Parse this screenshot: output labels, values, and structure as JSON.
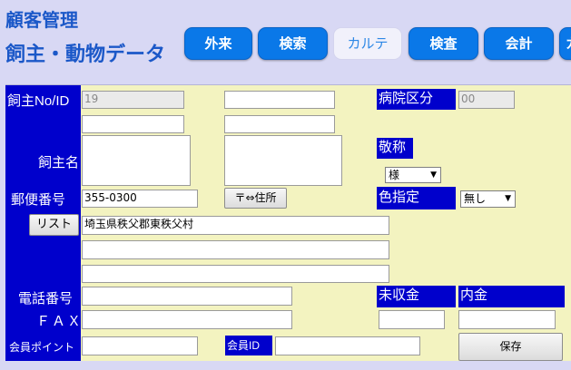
{
  "header": {
    "title_line1": "顧客管理",
    "title_line2": "飼主・動物データ"
  },
  "tabs": [
    {
      "label": "外来",
      "active": false
    },
    {
      "label": "検索",
      "active": false
    },
    {
      "label": "カルテ",
      "active": true
    },
    {
      "label": "検査",
      "active": false
    },
    {
      "label": "会計",
      "active": false
    },
    {
      "label": "カ",
      "active": false
    }
  ],
  "labels": {
    "owner_no": "飼主No/ID",
    "owner_name": "飼主名",
    "postal": "郵便番号",
    "phone": "電話番号",
    "fax": "ＦＡＸ",
    "member_points": "会員ポイント",
    "member_id": "会員ID",
    "hospital_section": "病院区分",
    "honorific": "敬称",
    "color": "色指定",
    "unpaid": "未収金",
    "deposit": "内金"
  },
  "fields": {
    "owner_no": "19",
    "hospital_section": "00",
    "postal_code": "355-0300",
    "address1": "埼玉県秩父郡東秩父村"
  },
  "selects": {
    "honorific": "様",
    "color": "無し"
  },
  "buttons": {
    "postal_to_address": "〒⇔住所",
    "list": "リスト",
    "save": "保存"
  },
  "colors": {
    "label_bg": "#0000cc",
    "panel_bg": "#f3f3c0",
    "tab_bg": "#0a78e8",
    "title": "#1b58c8"
  }
}
